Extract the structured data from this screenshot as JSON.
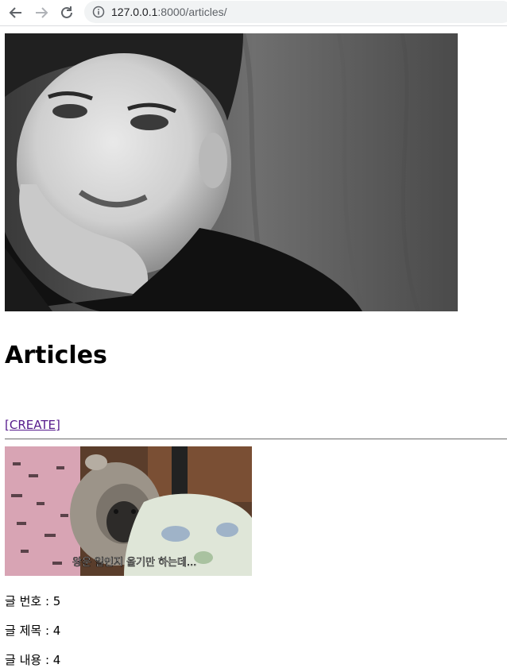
{
  "browser": {
    "url_host": "127.0.0.1",
    "url_rest": ":8000/articles/"
  },
  "page": {
    "title": "Articles",
    "create_link": "[CREATE]"
  },
  "article": {
    "number_label": "글 번호",
    "number_value": "5",
    "title_label": "글 제목",
    "title_value": "4",
    "content_label": "글 내용",
    "content_value": "4",
    "separator": " : ",
    "image_caption": "왕운 일인지 울기만 하는데..."
  },
  "icons": {
    "back": "arrow-left-icon",
    "forward": "arrow-right-icon",
    "reload": "reload-icon",
    "site_info": "info-icon"
  }
}
